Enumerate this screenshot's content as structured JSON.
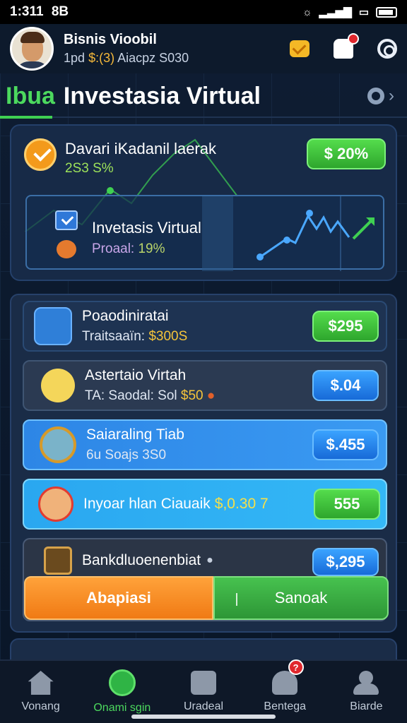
{
  "status_bar": {
    "time": "1:311",
    "carrier_glyph": "8B"
  },
  "header": {
    "user_name": "Bisnis Vioobil",
    "user_sub_prefix": "1pd",
    "user_sub_amount": "$:(3)",
    "user_sub_suffix": "Aiacpz S030",
    "icons": [
      "mail-icon",
      "bell-icon",
      "gear-icon"
    ]
  },
  "title_bar": {
    "prefix": "Ibua",
    "title": "Investasia Virtual"
  },
  "top_card": {
    "title": "Davari iKadanil laerak",
    "subtitle": "2S3 S%",
    "badge": "$ 20%",
    "inner_title": "Invetasis Virtual",
    "inner_label": "Proaal:",
    "inner_value": "19%"
  },
  "list": [
    {
      "title": "Poaodiniratai",
      "sub_label": "Traitsaaïn:",
      "sub_value": "$300S",
      "badge": "$295"
    },
    {
      "title": "Astertaio Virtah",
      "sub_label": "TA: Saodal: Sol",
      "sub_value": "$50",
      "badge": "$.04"
    },
    {
      "title": "Saiaraling Tiab",
      "sub_label": "6u Soajs 3S0",
      "sub_value": "",
      "badge": "$.455"
    },
    {
      "title": "Inyoar hlan Ciauaik",
      "sub_label": "",
      "sub_value": "$,0.30  7",
      "badge": "555"
    },
    {
      "title": "Bankdluoenenbiat",
      "sub_label": "",
      "sub_value": "",
      "badge": "$,295"
    }
  ],
  "actions": {
    "left": "Abapiasi",
    "right": "Sanoak"
  },
  "nav": [
    {
      "label": "Vonang",
      "icon": "home-icon"
    },
    {
      "label": "Onami sgin",
      "icon": "active-icon"
    },
    {
      "label": "Uradeal",
      "icon": "list-icon"
    },
    {
      "label": "Bentega",
      "icon": "bell-icon",
      "badge": "?"
    },
    {
      "label": "Biarde",
      "icon": "group-icon"
    }
  ],
  "colors": {
    "accent_green": "#4cd95e",
    "accent_blue": "#2f8ef0",
    "accent_orange": "#f39a1b",
    "badge_red": "#e0272d"
  }
}
